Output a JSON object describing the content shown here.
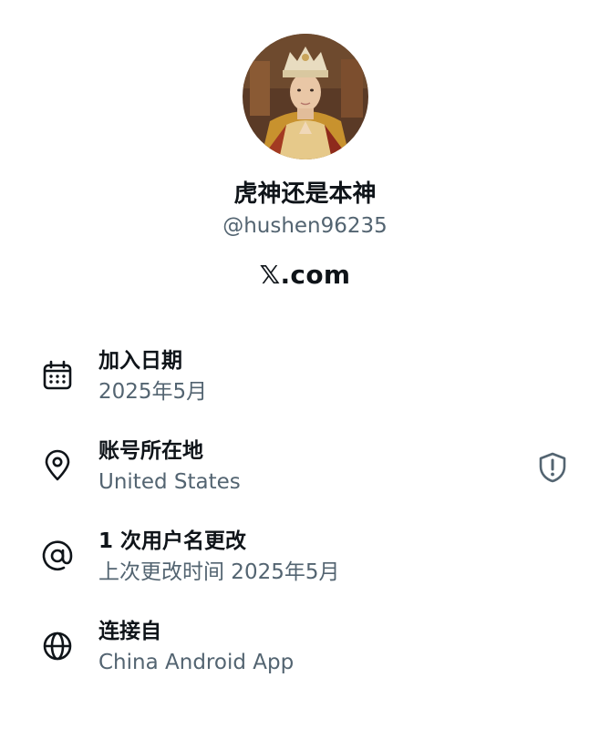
{
  "profile": {
    "display_name": "虎神还是本神",
    "handle": "@hushen96235",
    "site": "𝕏.com",
    "avatar_icon": "user-avatar-photo"
  },
  "about": {
    "joined": {
      "icon": "calendar-icon",
      "label": "加入日期",
      "value": "2025年5月"
    },
    "location": {
      "icon": "location-pin-icon",
      "label": "账号所在地",
      "value": "United States",
      "badge_icon": "shield-alert-icon"
    },
    "username_changes": {
      "icon": "at-sign-icon",
      "label": "1 次用户名更改",
      "value": "上次更改时间 2025年5月"
    },
    "connected_via": {
      "icon": "globe-icon",
      "label": "连接自",
      "value": "China Android App"
    }
  },
  "colors": {
    "primary_text": "#0f1419",
    "secondary_text": "#536471",
    "background": "#ffffff"
  }
}
